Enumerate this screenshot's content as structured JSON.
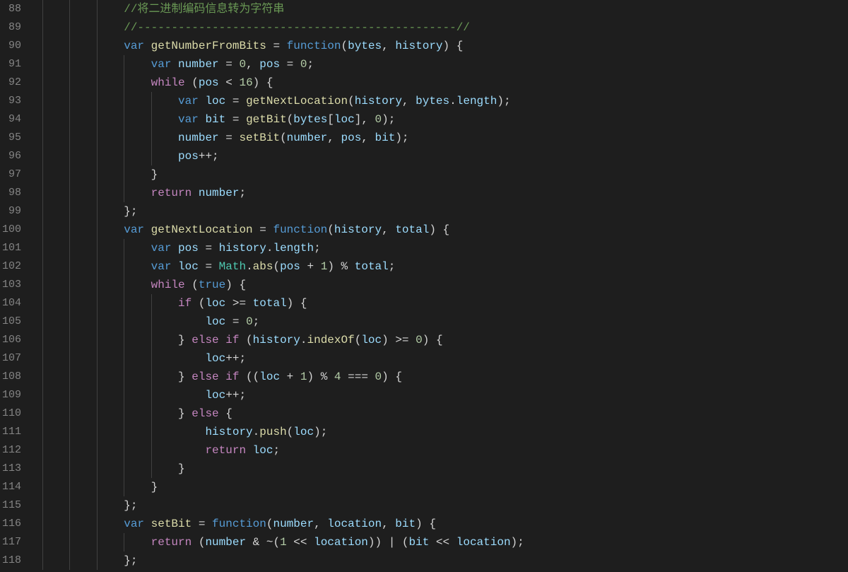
{
  "editor": {
    "first_line_number": 88,
    "last_line_number": 118,
    "indent_unit": "    ",
    "lines": [
      {
        "n": 88,
        "indent": 3,
        "tokens": [
          {
            "t": "//将二进制编码信息转为字符串",
            "c": "comment"
          }
        ]
      },
      {
        "n": 89,
        "indent": 3,
        "tokens": [
          {
            "t": "//-----------------------------------------------//",
            "c": "comment"
          }
        ]
      },
      {
        "n": 90,
        "indent": 3,
        "tokens": [
          {
            "t": "var ",
            "c": "keyword"
          },
          {
            "t": "getNumberFromBits",
            "c": "func"
          },
          {
            "t": " = ",
            "c": "default"
          },
          {
            "t": "function",
            "c": "keyword"
          },
          {
            "t": "(",
            "c": "default"
          },
          {
            "t": "bytes",
            "c": "param"
          },
          {
            "t": ", ",
            "c": "default"
          },
          {
            "t": "history",
            "c": "param"
          },
          {
            "t": ") {",
            "c": "default"
          }
        ]
      },
      {
        "n": 91,
        "indent": 4,
        "tokens": [
          {
            "t": "var ",
            "c": "keyword"
          },
          {
            "t": "number",
            "c": "var"
          },
          {
            "t": " = ",
            "c": "default"
          },
          {
            "t": "0",
            "c": "number"
          },
          {
            "t": ", ",
            "c": "default"
          },
          {
            "t": "pos",
            "c": "var"
          },
          {
            "t": " = ",
            "c": "default"
          },
          {
            "t": "0",
            "c": "number"
          },
          {
            "t": ";",
            "c": "default"
          }
        ]
      },
      {
        "n": 92,
        "indent": 4,
        "tokens": [
          {
            "t": "while",
            "c": "ctrl"
          },
          {
            "t": " (",
            "c": "default"
          },
          {
            "t": "pos",
            "c": "var"
          },
          {
            "t": " < ",
            "c": "default"
          },
          {
            "t": "16",
            "c": "number"
          },
          {
            "t": ") {",
            "c": "default"
          }
        ]
      },
      {
        "n": 93,
        "indent": 5,
        "tokens": [
          {
            "t": "var ",
            "c": "keyword"
          },
          {
            "t": "loc",
            "c": "var"
          },
          {
            "t": " = ",
            "c": "default"
          },
          {
            "t": "getNextLocation",
            "c": "func"
          },
          {
            "t": "(",
            "c": "default"
          },
          {
            "t": "history",
            "c": "var"
          },
          {
            "t": ", ",
            "c": "default"
          },
          {
            "t": "bytes",
            "c": "var"
          },
          {
            "t": ".",
            "c": "default"
          },
          {
            "t": "length",
            "c": "prop"
          },
          {
            "t": ");",
            "c": "default"
          }
        ]
      },
      {
        "n": 94,
        "indent": 5,
        "tokens": [
          {
            "t": "var ",
            "c": "keyword"
          },
          {
            "t": "bit",
            "c": "var"
          },
          {
            "t": " = ",
            "c": "default"
          },
          {
            "t": "getBit",
            "c": "func"
          },
          {
            "t": "(",
            "c": "default"
          },
          {
            "t": "bytes",
            "c": "var"
          },
          {
            "t": "[",
            "c": "default"
          },
          {
            "t": "loc",
            "c": "var"
          },
          {
            "t": "], ",
            "c": "default"
          },
          {
            "t": "0",
            "c": "number"
          },
          {
            "t": ");",
            "c": "default"
          }
        ]
      },
      {
        "n": 95,
        "indent": 5,
        "tokens": [
          {
            "t": "number",
            "c": "var"
          },
          {
            "t": " = ",
            "c": "default"
          },
          {
            "t": "setBit",
            "c": "func"
          },
          {
            "t": "(",
            "c": "default"
          },
          {
            "t": "number",
            "c": "var"
          },
          {
            "t": ", ",
            "c": "default"
          },
          {
            "t": "pos",
            "c": "var"
          },
          {
            "t": ", ",
            "c": "default"
          },
          {
            "t": "bit",
            "c": "var"
          },
          {
            "t": ");",
            "c": "default"
          }
        ]
      },
      {
        "n": 96,
        "indent": 5,
        "tokens": [
          {
            "t": "pos",
            "c": "var"
          },
          {
            "t": "++;",
            "c": "default"
          }
        ]
      },
      {
        "n": 97,
        "indent": 4,
        "tokens": [
          {
            "t": "}",
            "c": "default"
          }
        ]
      },
      {
        "n": 98,
        "indent": 4,
        "tokens": [
          {
            "t": "return ",
            "c": "ctrl"
          },
          {
            "t": "number",
            "c": "var"
          },
          {
            "t": ";",
            "c": "default"
          }
        ]
      },
      {
        "n": 99,
        "indent": 3,
        "tokens": [
          {
            "t": "};",
            "c": "default"
          }
        ]
      },
      {
        "n": 100,
        "indent": 3,
        "tokens": [
          {
            "t": "var ",
            "c": "keyword"
          },
          {
            "t": "getNextLocation",
            "c": "func"
          },
          {
            "t": " = ",
            "c": "default"
          },
          {
            "t": "function",
            "c": "keyword"
          },
          {
            "t": "(",
            "c": "default"
          },
          {
            "t": "history",
            "c": "param"
          },
          {
            "t": ", ",
            "c": "default"
          },
          {
            "t": "total",
            "c": "param"
          },
          {
            "t": ") {",
            "c": "default"
          }
        ]
      },
      {
        "n": 101,
        "indent": 4,
        "tokens": [
          {
            "t": "var ",
            "c": "keyword"
          },
          {
            "t": "pos",
            "c": "var"
          },
          {
            "t": " = ",
            "c": "default"
          },
          {
            "t": "history",
            "c": "var"
          },
          {
            "t": ".",
            "c": "default"
          },
          {
            "t": "length",
            "c": "prop"
          },
          {
            "t": ";",
            "c": "default"
          }
        ]
      },
      {
        "n": 102,
        "indent": 4,
        "tokens": [
          {
            "t": "var ",
            "c": "keyword"
          },
          {
            "t": "loc",
            "c": "var"
          },
          {
            "t": " = ",
            "c": "default"
          },
          {
            "t": "Math",
            "c": "obj"
          },
          {
            "t": ".",
            "c": "default"
          },
          {
            "t": "abs",
            "c": "func"
          },
          {
            "t": "(",
            "c": "default"
          },
          {
            "t": "pos",
            "c": "var"
          },
          {
            "t": " + ",
            "c": "default"
          },
          {
            "t": "1",
            "c": "number"
          },
          {
            "t": ") % ",
            "c": "default"
          },
          {
            "t": "total",
            "c": "var"
          },
          {
            "t": ";",
            "c": "default"
          }
        ]
      },
      {
        "n": 103,
        "indent": 4,
        "tokens": [
          {
            "t": "while",
            "c": "ctrl"
          },
          {
            "t": " (",
            "c": "default"
          },
          {
            "t": "true",
            "c": "const"
          },
          {
            "t": ") {",
            "c": "default"
          }
        ]
      },
      {
        "n": 104,
        "indent": 5,
        "tokens": [
          {
            "t": "if",
            "c": "ctrl"
          },
          {
            "t": " (",
            "c": "default"
          },
          {
            "t": "loc",
            "c": "var"
          },
          {
            "t": " >= ",
            "c": "default"
          },
          {
            "t": "total",
            "c": "var"
          },
          {
            "t": ") {",
            "c": "default"
          }
        ]
      },
      {
        "n": 105,
        "indent": 6,
        "tokens": [
          {
            "t": "loc",
            "c": "var"
          },
          {
            "t": " = ",
            "c": "default"
          },
          {
            "t": "0",
            "c": "number"
          },
          {
            "t": ";",
            "c": "default"
          }
        ]
      },
      {
        "n": 106,
        "indent": 5,
        "tokens": [
          {
            "t": "} ",
            "c": "default"
          },
          {
            "t": "else if",
            "c": "ctrl"
          },
          {
            "t": " (",
            "c": "default"
          },
          {
            "t": "history",
            "c": "var"
          },
          {
            "t": ".",
            "c": "default"
          },
          {
            "t": "indexOf",
            "c": "func"
          },
          {
            "t": "(",
            "c": "default"
          },
          {
            "t": "loc",
            "c": "var"
          },
          {
            "t": ") >= ",
            "c": "default"
          },
          {
            "t": "0",
            "c": "number"
          },
          {
            "t": ") {",
            "c": "default"
          }
        ]
      },
      {
        "n": 107,
        "indent": 6,
        "tokens": [
          {
            "t": "loc",
            "c": "var"
          },
          {
            "t": "++;",
            "c": "default"
          }
        ]
      },
      {
        "n": 108,
        "indent": 5,
        "tokens": [
          {
            "t": "} ",
            "c": "default"
          },
          {
            "t": "else if",
            "c": "ctrl"
          },
          {
            "t": " ((",
            "c": "default"
          },
          {
            "t": "loc",
            "c": "var"
          },
          {
            "t": " + ",
            "c": "default"
          },
          {
            "t": "1",
            "c": "number"
          },
          {
            "t": ") % ",
            "c": "default"
          },
          {
            "t": "4",
            "c": "number"
          },
          {
            "t": " === ",
            "c": "default"
          },
          {
            "t": "0",
            "c": "number"
          },
          {
            "t": ") {",
            "c": "default"
          }
        ]
      },
      {
        "n": 109,
        "indent": 6,
        "tokens": [
          {
            "t": "loc",
            "c": "var"
          },
          {
            "t": "++;",
            "c": "default"
          }
        ]
      },
      {
        "n": 110,
        "indent": 5,
        "tokens": [
          {
            "t": "} ",
            "c": "default"
          },
          {
            "t": "else",
            "c": "ctrl"
          },
          {
            "t": " {",
            "c": "default"
          }
        ]
      },
      {
        "n": 111,
        "indent": 6,
        "tokens": [
          {
            "t": "history",
            "c": "var"
          },
          {
            "t": ".",
            "c": "default"
          },
          {
            "t": "push",
            "c": "func"
          },
          {
            "t": "(",
            "c": "default"
          },
          {
            "t": "loc",
            "c": "var"
          },
          {
            "t": ");",
            "c": "default"
          }
        ]
      },
      {
        "n": 112,
        "indent": 6,
        "tokens": [
          {
            "t": "return ",
            "c": "ctrl"
          },
          {
            "t": "loc",
            "c": "var"
          },
          {
            "t": ";",
            "c": "default"
          }
        ]
      },
      {
        "n": 113,
        "indent": 5,
        "tokens": [
          {
            "t": "}",
            "c": "default"
          }
        ]
      },
      {
        "n": 114,
        "indent": 4,
        "tokens": [
          {
            "t": "}",
            "c": "default"
          }
        ]
      },
      {
        "n": 115,
        "indent": 3,
        "tokens": [
          {
            "t": "};",
            "c": "default"
          }
        ]
      },
      {
        "n": 116,
        "indent": 3,
        "tokens": [
          {
            "t": "var ",
            "c": "keyword"
          },
          {
            "t": "setBit",
            "c": "func"
          },
          {
            "t": " = ",
            "c": "default"
          },
          {
            "t": "function",
            "c": "keyword"
          },
          {
            "t": "(",
            "c": "default"
          },
          {
            "t": "number",
            "c": "param"
          },
          {
            "t": ", ",
            "c": "default"
          },
          {
            "t": "location",
            "c": "param"
          },
          {
            "t": ", ",
            "c": "default"
          },
          {
            "t": "bit",
            "c": "param"
          },
          {
            "t": ") {",
            "c": "default"
          }
        ]
      },
      {
        "n": 117,
        "indent": 4,
        "tokens": [
          {
            "t": "return ",
            "c": "ctrl"
          },
          {
            "t": "(",
            "c": "default"
          },
          {
            "t": "number",
            "c": "var"
          },
          {
            "t": " & ~(",
            "c": "default"
          },
          {
            "t": "1",
            "c": "number"
          },
          {
            "t": " << ",
            "c": "default"
          },
          {
            "t": "location",
            "c": "var"
          },
          {
            "t": ")) | (",
            "c": "default"
          },
          {
            "t": "bit",
            "c": "var"
          },
          {
            "t": " << ",
            "c": "default"
          },
          {
            "t": "location",
            "c": "var"
          },
          {
            "t": ");",
            "c": "default"
          }
        ]
      },
      {
        "n": 118,
        "indent": 3,
        "tokens": [
          {
            "t": "};",
            "c": "default"
          }
        ]
      }
    ],
    "indent_guide_columns": [
      1,
      2,
      3,
      4,
      5
    ]
  }
}
